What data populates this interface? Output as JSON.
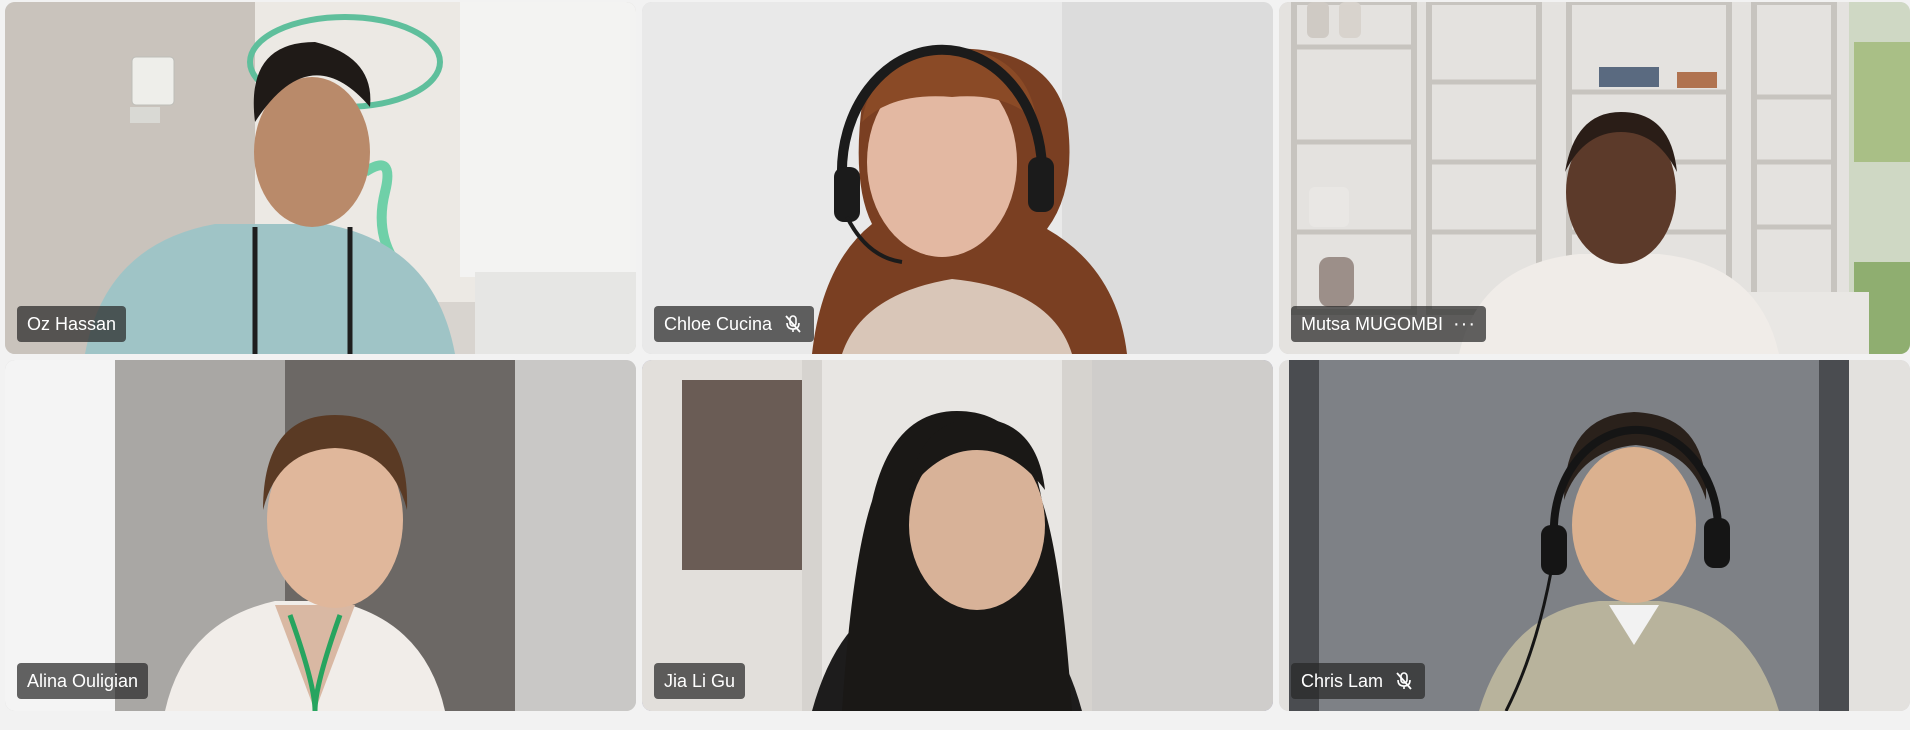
{
  "meeting": {
    "accent_color": "#5b5fc7",
    "participants": [
      {
        "name": "Oz Hassan",
        "muted": false,
        "speaking": false,
        "more": false
      },
      {
        "name": "Chloe Cucina",
        "muted": true,
        "speaking": false,
        "more": false
      },
      {
        "name": "Mutsa MUGOMBI",
        "muted": false,
        "speaking": false,
        "more": true,
        "more_label": "···"
      },
      {
        "name": "Alina Ouligian",
        "muted": false,
        "speaking": false,
        "more": false
      },
      {
        "name": "Jia Li Gu",
        "muted": false,
        "speaking": true,
        "more": false
      },
      {
        "name": "Chris Lam",
        "muted": true,
        "speaking": false,
        "more": false
      }
    ],
    "icons": {
      "muted": "mic-off-icon",
      "more": "more-options-icon"
    }
  }
}
